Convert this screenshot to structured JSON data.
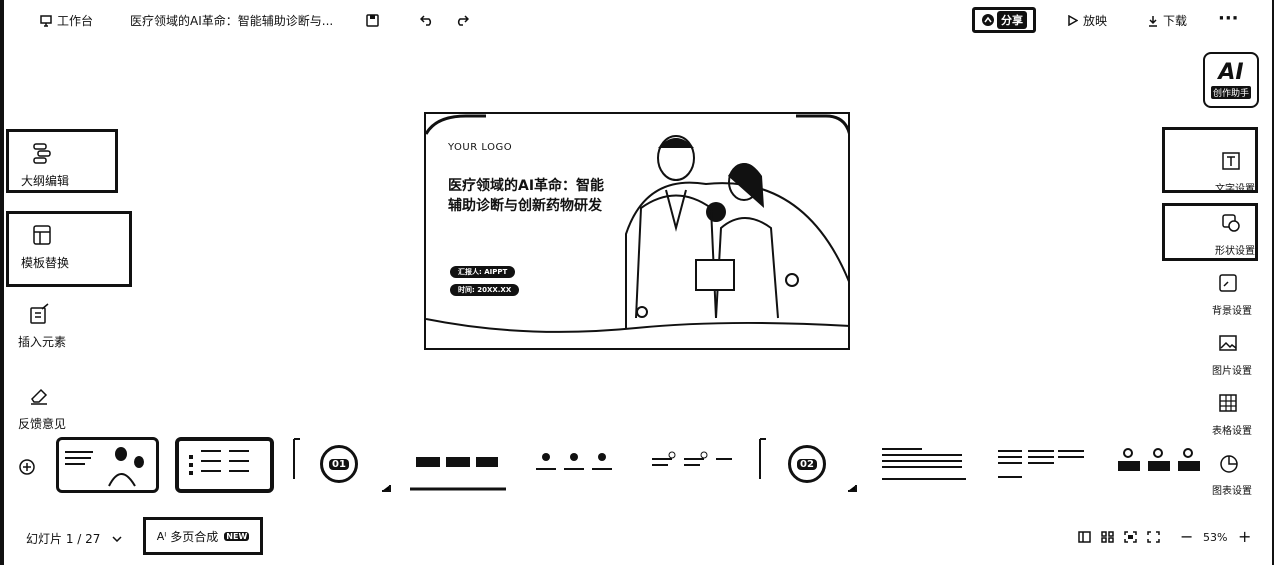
{
  "topbar": {
    "workspace_label": "工作台",
    "doc_title": "医疗领域的AI革命：智能辅助诊断与...",
    "share_label": "分享",
    "present_label": "放映",
    "download_label": "下载"
  },
  "ai_badge": {
    "big": "AI",
    "small": "创作助手"
  },
  "left_tools": [
    {
      "label": "大纲编辑",
      "icon": "outline-icon"
    },
    {
      "label": "模板替换",
      "icon": "template-icon"
    },
    {
      "label": "插入元素",
      "icon": "insert-element-icon"
    },
    {
      "label": "反馈意见",
      "icon": "feedback-icon"
    }
  ],
  "right_tools": [
    {
      "label": "文字设置",
      "icon": "text-icon"
    },
    {
      "label": "形状设置",
      "icon": "shape-icon"
    },
    {
      "label": "背景设置",
      "icon": "background-icon"
    },
    {
      "label": "图片设置",
      "icon": "image-icon"
    },
    {
      "label": "表格设置",
      "icon": "table-icon"
    },
    {
      "label": "图表设置",
      "icon": "chart-icon"
    }
  ],
  "slide": {
    "logo": "YOUR LOGO",
    "title": "医疗领域的AI革命：智能辅助诊断与创新药物研发",
    "presenter": "汇报人: AIPPT",
    "time": "时间: 20XX.XX"
  },
  "thumbnails": [
    {
      "num": ""
    },
    {
      "num": ""
    },
    {
      "num": "01"
    },
    {
      "num": ""
    },
    {
      "num": ""
    },
    {
      "num": ""
    },
    {
      "num": "02"
    },
    {
      "num": ""
    },
    {
      "num": ""
    },
    {
      "num": ""
    }
  ],
  "bottom": {
    "slide_counter": "幻灯片 1 / 27",
    "multi_page_label": "多页合成",
    "new_tag": "NEW",
    "zoom": "53%"
  }
}
